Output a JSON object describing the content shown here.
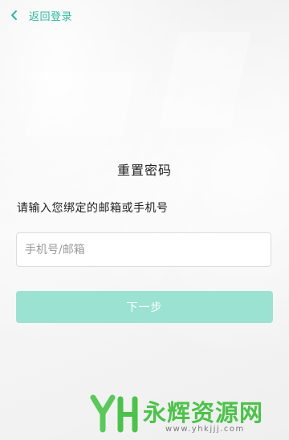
{
  "header": {
    "back_label": "返回登录"
  },
  "main": {
    "title": "重置密码",
    "hint": "请输入您绑定的邮箱或手机号",
    "account_input": {
      "value": "",
      "placeholder": "手机号/邮箱"
    },
    "next_button_label": "下一步"
  },
  "watermark": {
    "title": "永辉资源网",
    "url": "www.yhkjjj.com"
  },
  "colors": {
    "accent": "#2fb79b",
    "button_disabled": "#9be2d2",
    "watermark_green": "#4cc24a"
  },
  "icons": {
    "back": "chevron-left-icon",
    "watermark_logo": "yh-logo-icon"
  }
}
